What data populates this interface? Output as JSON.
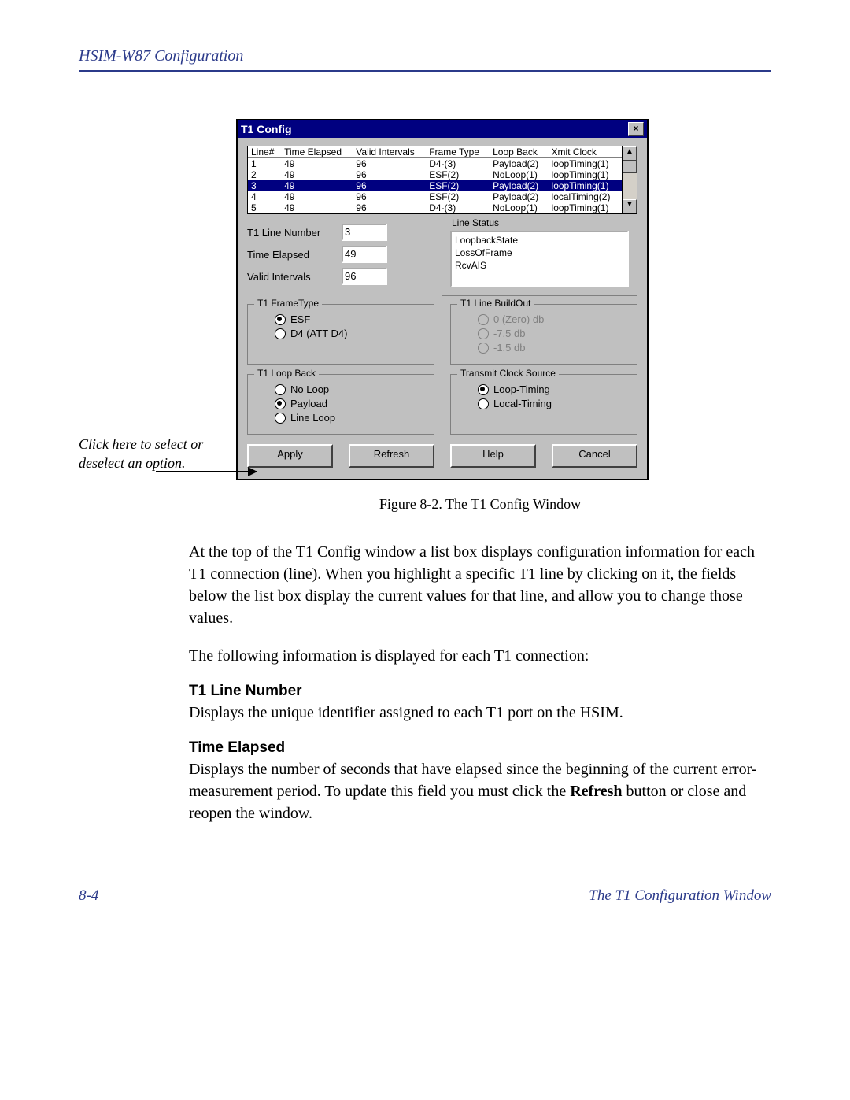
{
  "page": {
    "header": "HSIM-W87 Configuration",
    "page_number": "8-4",
    "footer_right": "The T1 Configuration Window",
    "annotation": "Click here to select or deselect an option.",
    "figure_caption": "Figure 8-2.  The T1 Config Window"
  },
  "window": {
    "title": "T1 Config",
    "columns": [
      "Line#",
      "Time Elapsed",
      "Valid Intervals",
      "Frame Type",
      "Loop Back",
      "Xmit Clock"
    ],
    "rows": [
      {
        "line": "1",
        "te": "49",
        "vi": "96",
        "ft": "D4-(3)",
        "lb": "Payload(2)",
        "xc": "loopTiming(1)"
      },
      {
        "line": "2",
        "te": "49",
        "vi": "96",
        "ft": "ESF(2)",
        "lb": "NoLoop(1)",
        "xc": "loopTiming(1)"
      },
      {
        "line": "3",
        "te": "49",
        "vi": "96",
        "ft": "ESF(2)",
        "lb": "Payload(2)",
        "xc": "loopTiming(1)"
      },
      {
        "line": "4",
        "te": "49",
        "vi": "96",
        "ft": "ESF(2)",
        "lb": "Payload(2)",
        "xc": "localTiming(2)"
      },
      {
        "line": "5",
        "te": "49",
        "vi": "96",
        "ft": "D4-(3)",
        "lb": "NoLoop(1)",
        "xc": "loopTiming(1)"
      }
    ],
    "selected_row_index": 2,
    "fields": {
      "line_number_label": "T1 Line Number",
      "line_number_value": "3",
      "time_elapsed_label": "Time Elapsed",
      "time_elapsed_value": "49",
      "valid_intervals_label": "Valid Intervals",
      "valid_intervals_value": "96"
    },
    "line_status": {
      "title": "Line Status",
      "items": [
        "LoopbackState",
        "LossOfFrame",
        "RcvAIS"
      ]
    },
    "frametype": {
      "title": "T1 FrameType",
      "options": [
        "ESF",
        "D4 (ATT D4)"
      ],
      "selected": 0
    },
    "buildout": {
      "title": "T1 Line BuildOut",
      "options": [
        "0 (Zero) db",
        "-7.5 db",
        "-1.5 db"
      ],
      "disabled": true
    },
    "loopback": {
      "title": "T1 Loop Back",
      "options": [
        "No Loop",
        "Payload",
        "Line Loop"
      ],
      "selected": 1
    },
    "clock": {
      "title": "Transmit Clock Source",
      "options": [
        "Loop-Timing",
        "Local-Timing"
      ],
      "selected": 0
    },
    "buttons": {
      "apply": "Apply",
      "refresh": "Refresh",
      "help": "Help",
      "cancel": "Cancel"
    }
  },
  "body": {
    "p1": "At the top of the T1 Config window a list box displays configuration information for each T1 connection (line). When you highlight a specific T1 line by clicking on it, the fields below the list box display the current values for that line, and allow you to change those values.",
    "p2": "The following information is displayed for each T1 connection:",
    "h1": "T1 Line Number",
    "p3": "Displays the unique identifier assigned to each T1 port on the HSIM.",
    "h2": "Time Elapsed",
    "p4a": "Displays the number of seconds that have elapsed since the beginning of the current error-measurement period. To update this field you must click the ",
    "p4b": "Refresh",
    "p4c": " button or close and reopen the window."
  }
}
